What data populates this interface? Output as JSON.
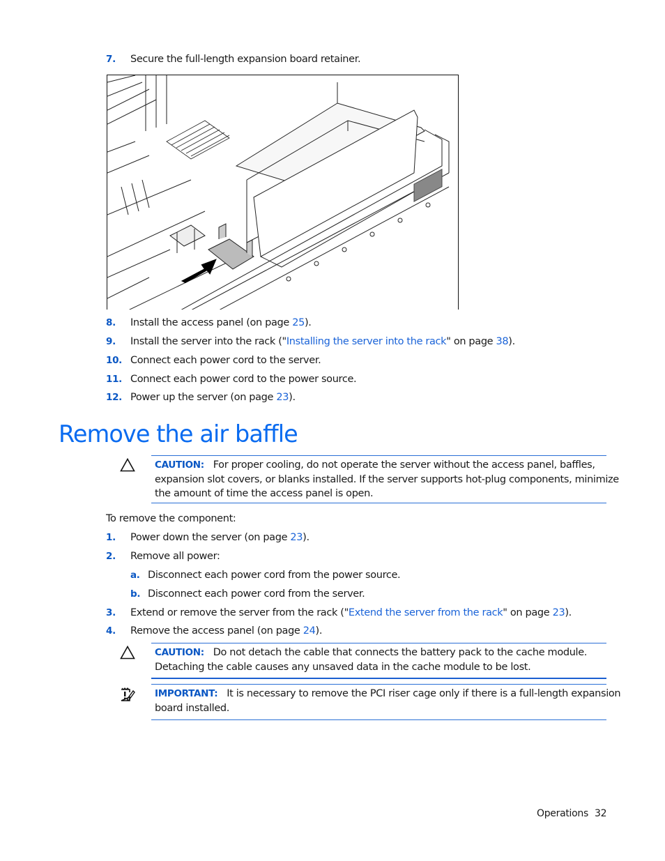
{
  "top_step": {
    "number": "7.",
    "text": "Secure the full-length expansion board retainer."
  },
  "figure": {
    "description": "Isometric line drawing of server chassis showing full-length expansion board retainer being secured; arrow points to retainer"
  },
  "steps_after_figure": [
    {
      "number": "8.",
      "before": "Install the access panel (on page ",
      "link": "25",
      "after": ")."
    },
    {
      "number": "9.",
      "before": "Install the server into the rack (\"",
      "link": "Installing the server into the rack",
      "middle": "\" on page ",
      "link2": "38",
      "after": ")."
    },
    {
      "number": "10.",
      "text": "Connect each power cord to the server."
    },
    {
      "number": "11.",
      "text": "Connect each power cord to the power source."
    },
    {
      "number": "12.",
      "before": "Power up the server (on page ",
      "link": "23",
      "after": ")."
    }
  ],
  "section": {
    "title": "Remove the air baffle"
  },
  "caution1": {
    "label": "CAUTION:",
    "line1": "For proper cooling, do not operate the server without the access panel, baffles,",
    "line2": "expansion slot covers, or blanks installed. If the server supports hot-plug components, minimize",
    "line3": "the amount of time the access panel is open."
  },
  "intro": "To remove the component:",
  "removal_steps": [
    {
      "number": "1.",
      "before": "Power down the server (on page ",
      "link": "23",
      "after": ")."
    },
    {
      "number": "2.",
      "text": "Remove all power:"
    },
    {
      "number": "a.",
      "text": "Disconnect each power cord from the power source."
    },
    {
      "number": "b.",
      "text": "Disconnect each power cord from the server."
    },
    {
      "number": "3.",
      "before": "Extend or remove the server from the rack (\"",
      "link": "Extend the server from the rack",
      "middle": "\" on page ",
      "link2": "23",
      "after": ")."
    },
    {
      "number": "4.",
      "before": "Remove the access panel (on page ",
      "link": "24",
      "after": ")."
    }
  ],
  "caution2": {
    "label": "CAUTION:",
    "line1": "Do not detach the cable that connects the battery pack to the cache module.",
    "line2": "Detaching the cable causes any unsaved data in the cache module to be lost."
  },
  "important": {
    "label": "IMPORTANT:",
    "line1": "It is necessary to remove the PCI riser cage only if there is a full-length expansion",
    "line2": "board installed."
  },
  "footer": {
    "section": "Operations",
    "page": "32"
  },
  "colors": {
    "accent": "#0a6bf0",
    "link": "#1a63d8",
    "rule": "#2a6fd6"
  }
}
